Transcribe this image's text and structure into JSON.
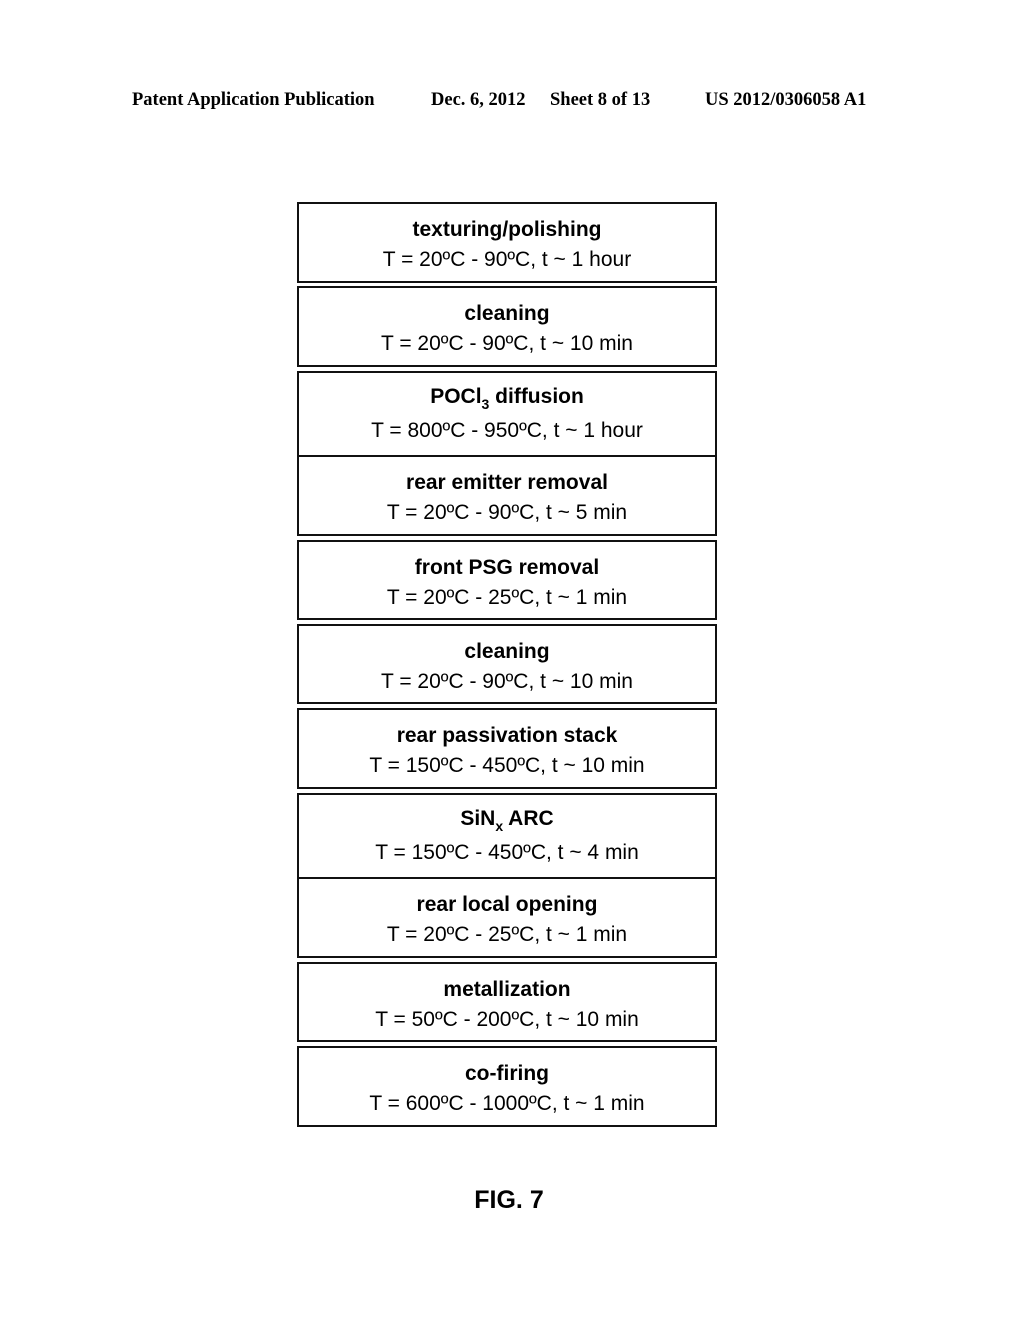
{
  "header": {
    "publication": "Patent Application Publication",
    "date": "Dec. 6, 2012",
    "sheet": "Sheet 8 of 13",
    "number": "US 2012/0306058 A1"
  },
  "steps": [
    {
      "title": "texturing/polishing",
      "conditions": "T = 20ºC - 90ºC, t ~ 1 hour"
    },
    {
      "title": "cleaning",
      "conditions": "T = 20ºC - 90ºC, t ~ 10 min"
    },
    {
      "title_main": "POCl",
      "title_sub": "3",
      "title_rest": " diffusion",
      "conditions": "T = 800ºC - 950ºC, t ~ 1 hour"
    },
    {
      "title": "rear emitter removal",
      "conditions": "T = 20ºC - 90ºC, t ~ 5 min"
    },
    {
      "title": "front PSG removal",
      "conditions": "T = 20ºC - 25ºC, t ~ 1 min"
    },
    {
      "title": "cleaning",
      "conditions": "T = 20ºC - 90ºC, t ~ 10 min"
    },
    {
      "title": "rear passivation stack",
      "conditions": "T = 150ºC - 450ºC, t ~ 10 min"
    },
    {
      "title_main": "SiN",
      "title_sub": "x",
      "title_rest": " ARC",
      "conditions": "T = 150ºC - 450ºC, t ~ 4 min"
    },
    {
      "title": "rear local opening",
      "conditions": "T = 20ºC - 25ºC, t ~ 1 min"
    },
    {
      "title": "metallization",
      "conditions": "T = 50ºC - 200ºC, t ~ 10 min"
    },
    {
      "title": "co-firing",
      "conditions": "T = 600ºC - 1000ºC, t ~ 1 min"
    }
  ],
  "figure_label": "FIG. 7"
}
